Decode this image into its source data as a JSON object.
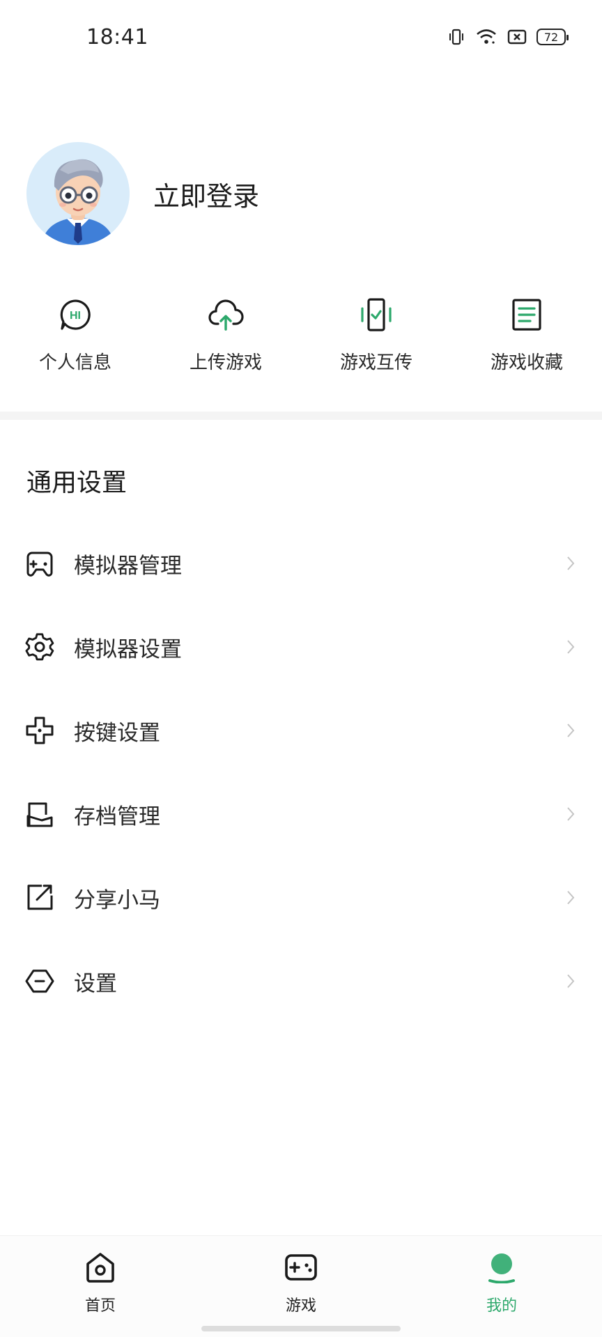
{
  "status_bar": {
    "time": "18:41",
    "battery": "72"
  },
  "profile": {
    "login_label": "立即登录"
  },
  "quick_actions": [
    {
      "label": "个人信息",
      "icon": "hi-bubble-icon"
    },
    {
      "label": "上传游戏",
      "icon": "cloud-upload-icon"
    },
    {
      "label": "游戏互传",
      "icon": "phone-transfer-icon"
    },
    {
      "label": "游戏收藏",
      "icon": "document-list-icon"
    }
  ],
  "settings": {
    "title": "通用设置",
    "items": [
      {
        "label": "模拟器管理",
        "icon": "gamepad-icon"
      },
      {
        "label": "模拟器设置",
        "icon": "gear-icon"
      },
      {
        "label": "按键设置",
        "icon": "dpad-icon"
      },
      {
        "label": "存档管理",
        "icon": "save-tray-icon"
      },
      {
        "label": "分享小马",
        "icon": "share-external-icon"
      },
      {
        "label": "设置",
        "icon": "hexagon-minus-icon"
      }
    ]
  },
  "bottom_nav": {
    "items": [
      {
        "label": "首页",
        "icon": "home-icon",
        "active": false
      },
      {
        "label": "游戏",
        "icon": "gamepad-nav-icon",
        "active": false
      },
      {
        "label": "我的",
        "icon": "profile-icon",
        "active": true
      }
    ]
  },
  "colors": {
    "accent": "#2ca86b",
    "icon_stroke": "#1a1a1a",
    "divider": "#f4f4f4"
  }
}
